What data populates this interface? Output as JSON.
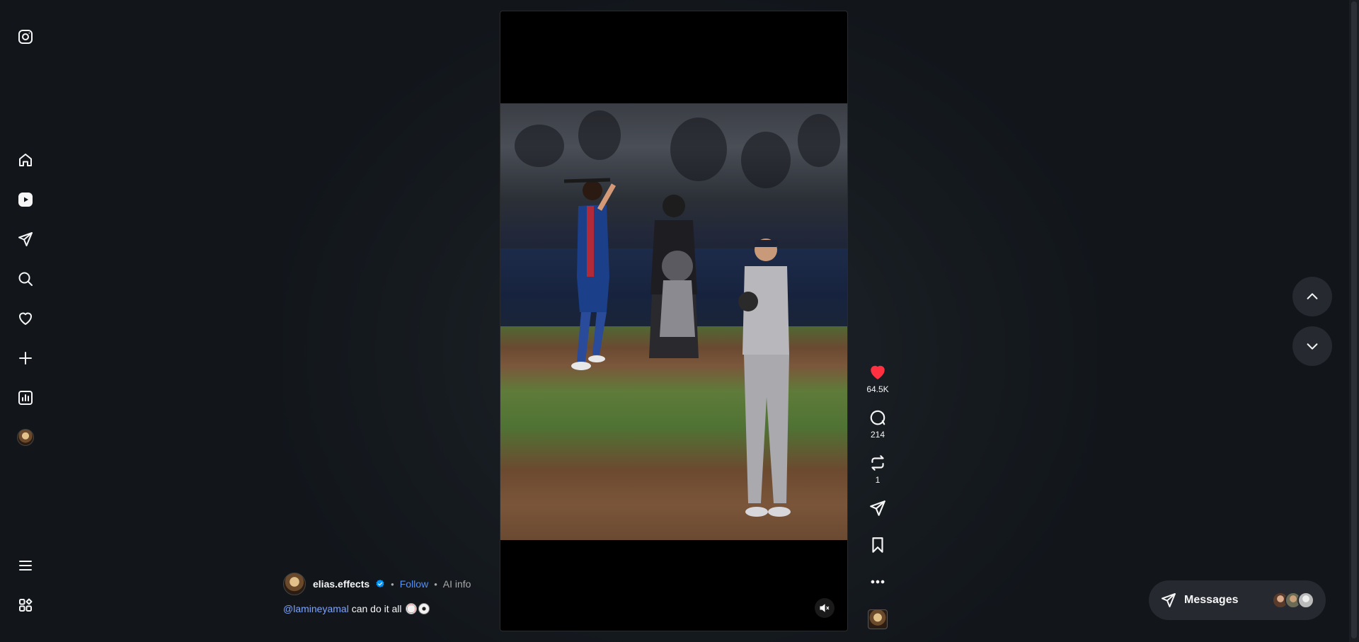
{
  "nav": {
    "items": [
      {
        "name": "instagram-logo-icon",
        "label": "Instagram"
      },
      {
        "name": "home-icon",
        "label": "Home"
      },
      {
        "name": "reels-icon",
        "label": "Reels"
      },
      {
        "name": "direct-icon",
        "label": "Messages"
      },
      {
        "name": "search-icon",
        "label": "Search"
      },
      {
        "name": "heart-icon",
        "label": "Notifications"
      },
      {
        "name": "plus-icon",
        "label": "Create"
      },
      {
        "name": "insights-icon",
        "label": "Dashboard"
      },
      {
        "name": "profile-avatar",
        "label": "Profile"
      },
      {
        "name": "menu-icon",
        "label": "More"
      },
      {
        "name": "apps-icon",
        "label": "Also from Meta"
      }
    ]
  },
  "post": {
    "username": "elias.effects",
    "separator": "•",
    "follow_label": "Follow",
    "ai_info": "AI info",
    "mention": "@lamineyamal",
    "caption": "can do it all"
  },
  "actions": {
    "likes": "64.5K",
    "comments": "214",
    "reposts": "1"
  },
  "messages": {
    "label": "Messages"
  },
  "colors": {
    "background": "#12161b",
    "accent_link": "#4f8fff",
    "like_red": "#ff3040",
    "verified_blue": "#0095f6"
  }
}
